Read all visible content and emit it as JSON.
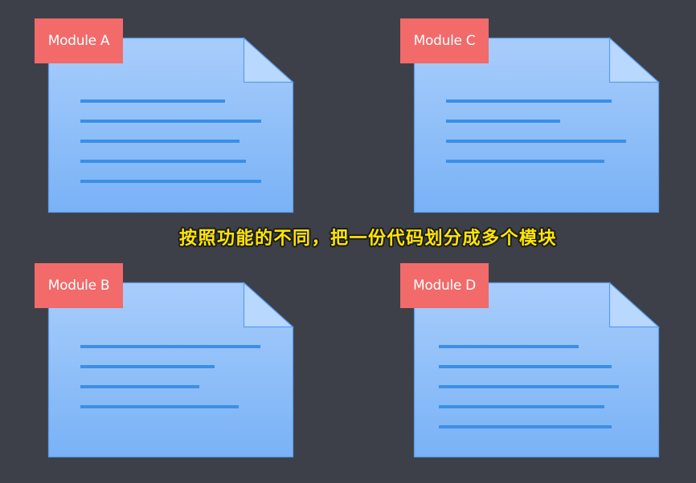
{
  "modules": [
    {
      "label": "Module A",
      "lines": 5
    },
    {
      "label": "Module C",
      "lines": 4
    },
    {
      "label": "Module B",
      "lines": 4
    },
    {
      "label": "Module D",
      "lines": 5
    }
  ],
  "caption": "按照功能的不同，把一份代码划分成多个模块",
  "colors": {
    "background": "#3d4048",
    "tag": "#f26a6a",
    "page_top": "#a8cdfb",
    "page_bottom": "#79b2f6",
    "page_border": "#5a9cf0",
    "text_line": "#3b8fe6",
    "caption": "#ffe600"
  }
}
